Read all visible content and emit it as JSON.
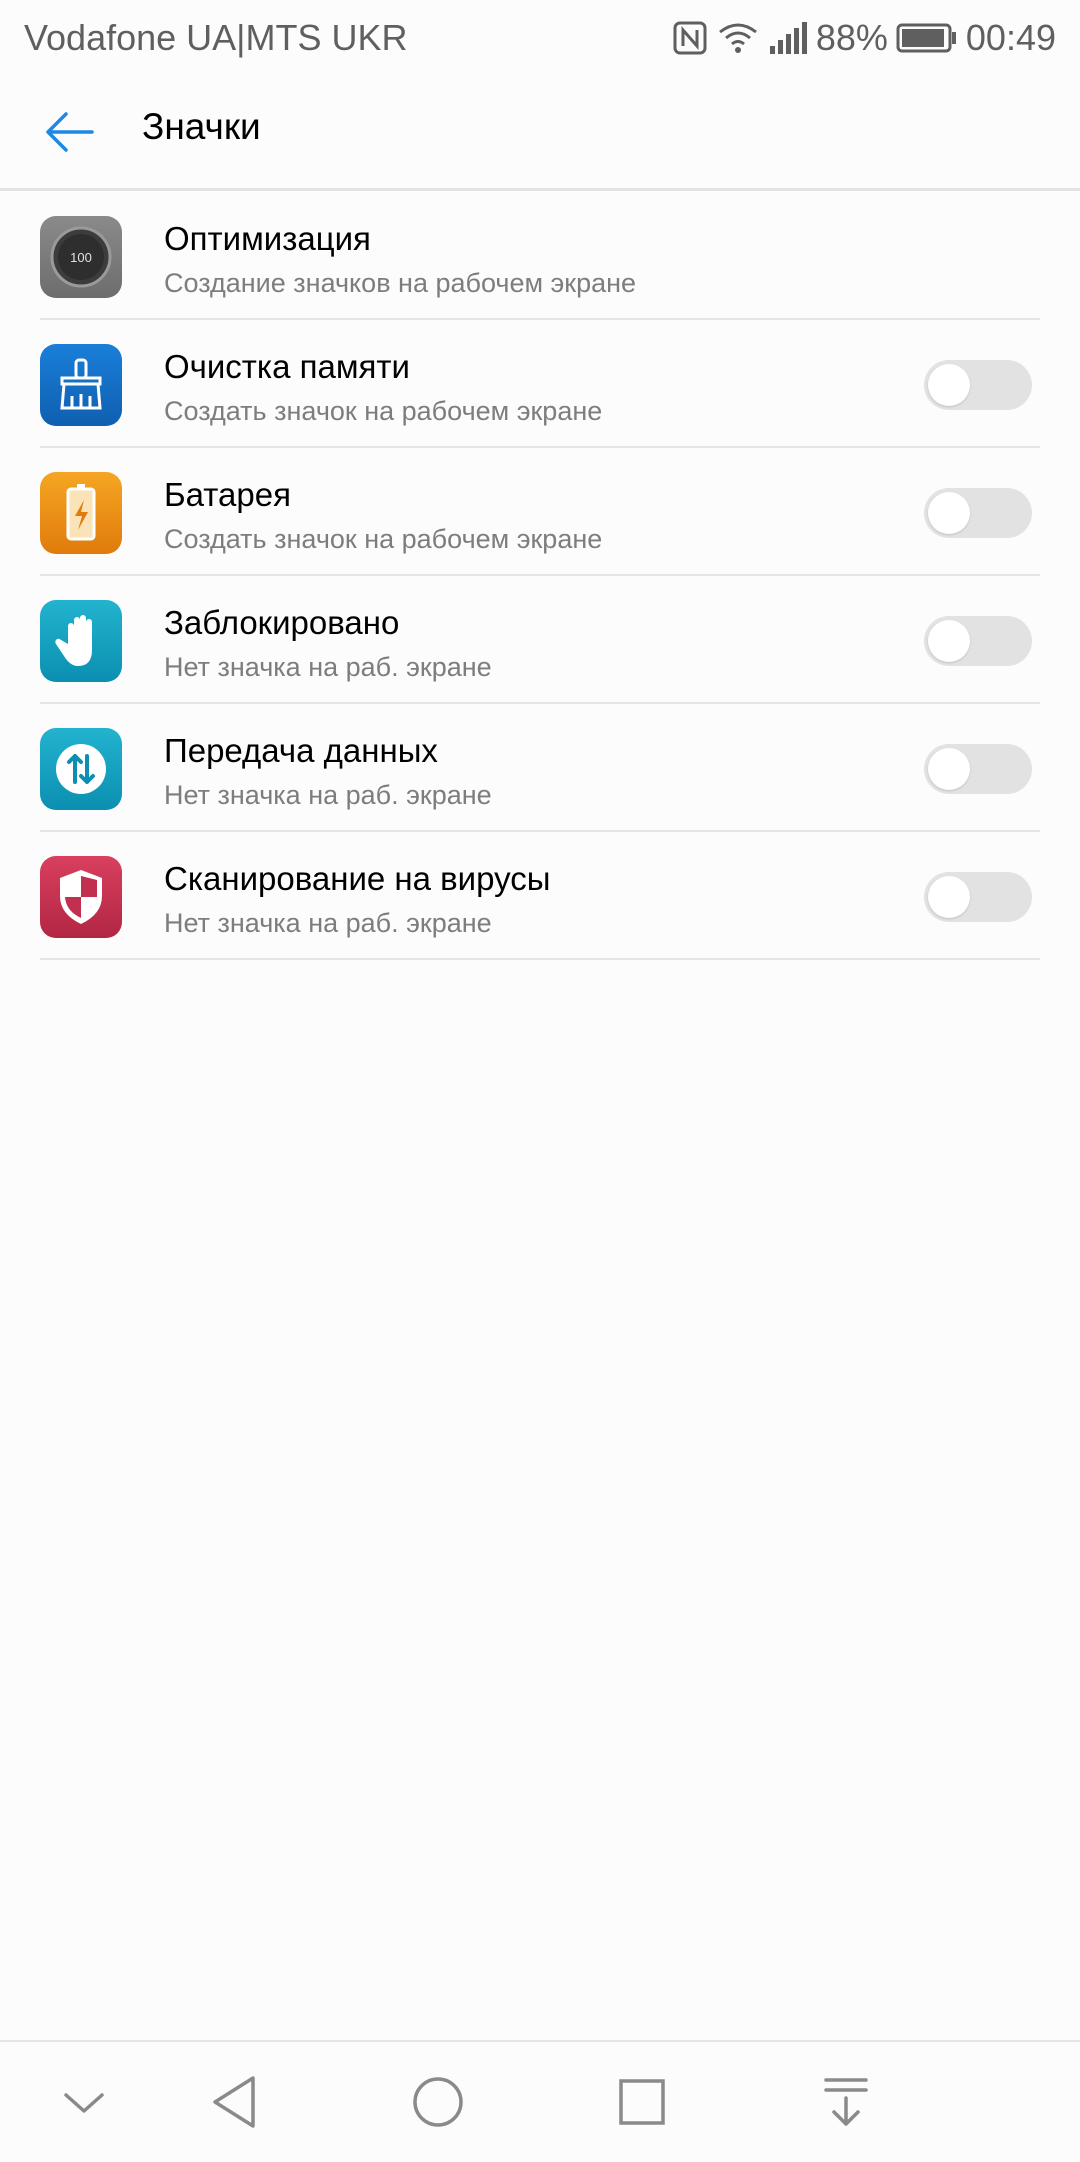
{
  "status_bar": {
    "carrier": "Vodafone UA|MTS UKR",
    "battery_percent": "88%",
    "time": "00:49",
    "icons": [
      "nfc-icon",
      "wifi-icon",
      "signal-icon",
      "battery-icon"
    ]
  },
  "app_bar": {
    "title": "Значки",
    "back_icon": "arrow-left-icon"
  },
  "colors": {
    "accent": "#1e88e5",
    "toggle_off_track": "#e2e2e2"
  },
  "items": [
    {
      "title": "Оптимизация",
      "subtitle": "Создание значков на рабочем экране",
      "icon": "optimization-gauge-icon",
      "icon_label": "100",
      "toggle": null
    },
    {
      "title": "Очистка памяти",
      "subtitle": "Создать значок на рабочем экране",
      "icon": "broom-icon",
      "toggle": false
    },
    {
      "title": "Батарея",
      "subtitle": "Создать значок на рабочем экране",
      "icon": "battery-bolt-icon",
      "toggle": false
    },
    {
      "title": "Заблокировано",
      "subtitle": "Нет значка на раб. экране",
      "icon": "hand-block-icon",
      "toggle": false
    },
    {
      "title": "Передача данных",
      "subtitle": "Нет значка на раб. экране",
      "icon": "data-transfer-icon",
      "toggle": false
    },
    {
      "title": "Сканирование на вирусы",
      "subtitle": "Нет значка на раб. экране",
      "icon": "shield-icon",
      "toggle": false
    }
  ],
  "nav_bar": {
    "buttons": [
      "collapse-chevron-icon",
      "back-triangle-icon",
      "home-circle-icon",
      "recents-square-icon",
      "notification-pull-icon"
    ]
  }
}
